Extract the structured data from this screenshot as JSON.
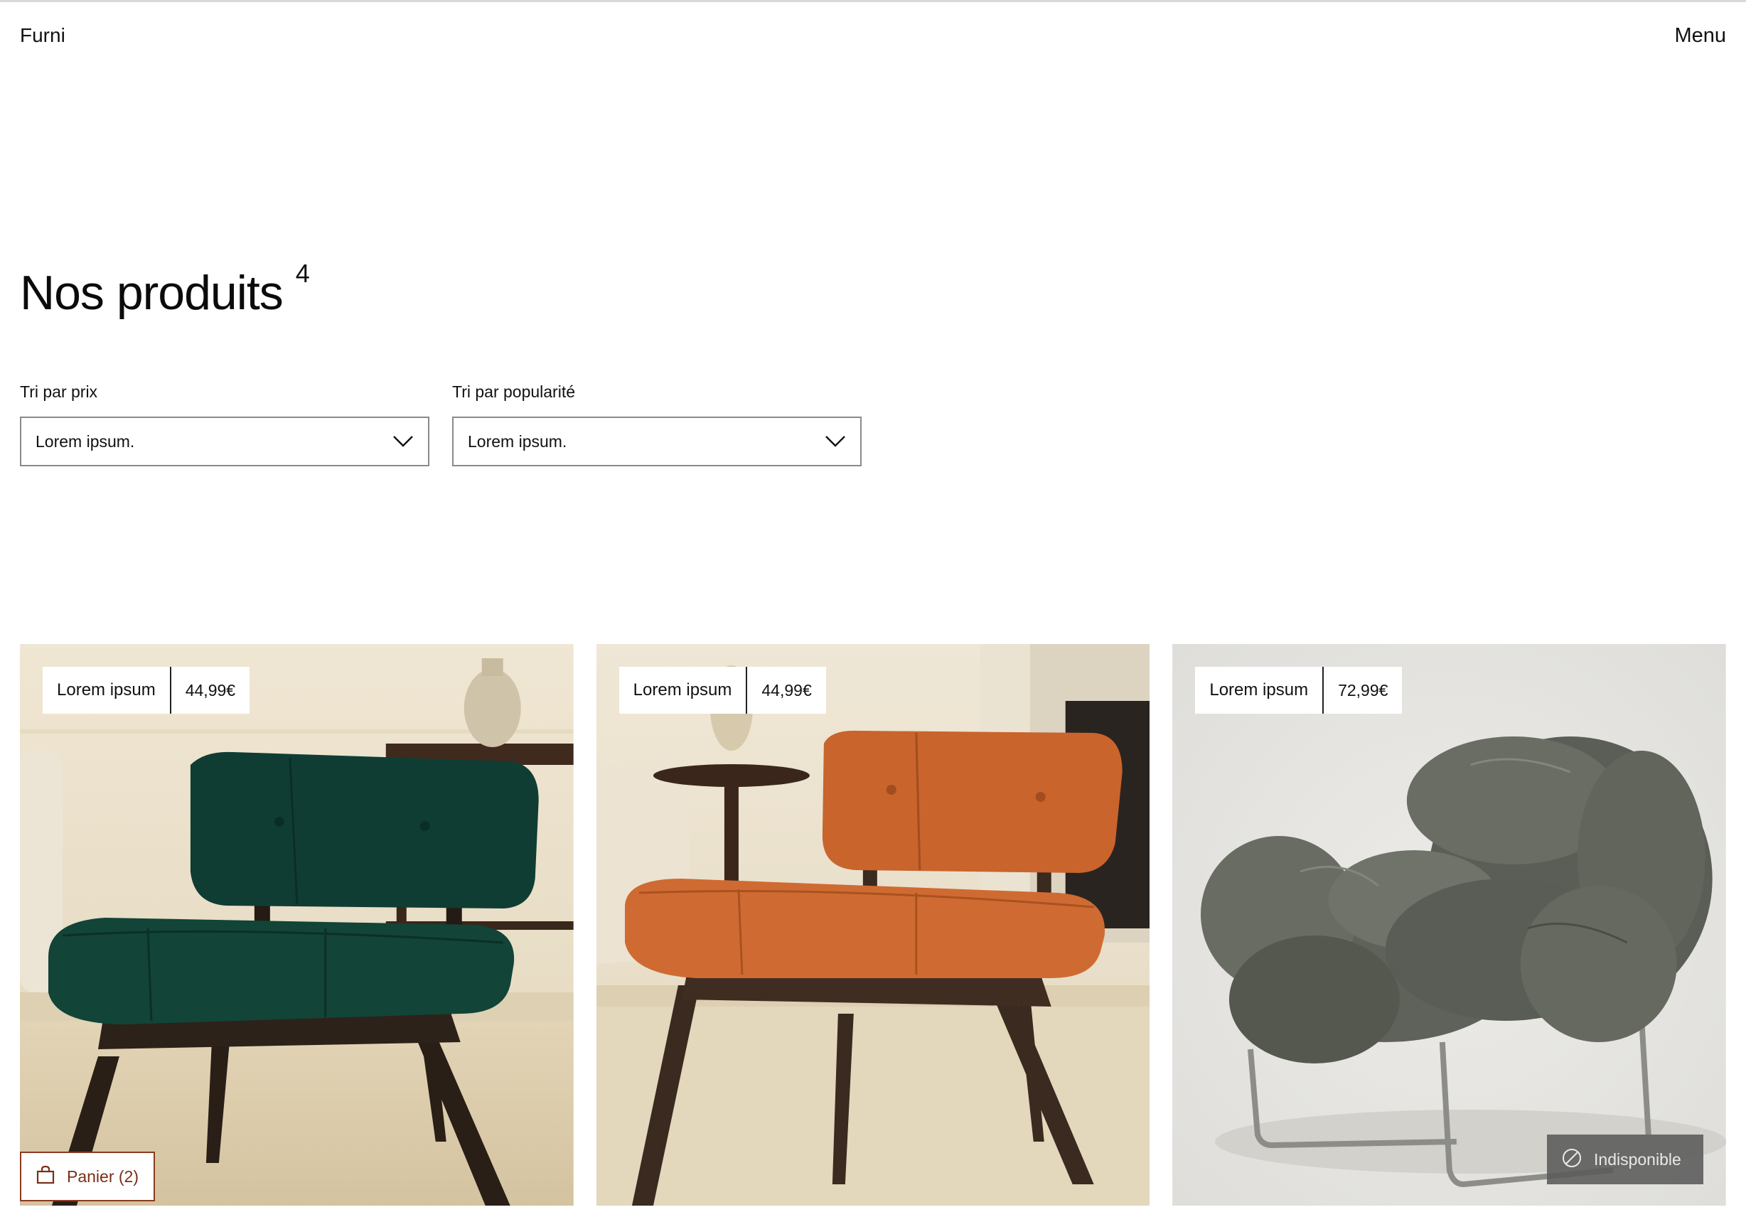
{
  "header": {
    "brand": "Furni",
    "menu_label": "Menu"
  },
  "page": {
    "title": "Nos produits",
    "count": "4"
  },
  "filters": [
    {
      "label": "Tri par prix",
      "value": "Lorem ipsum.",
      "icon": "chevron-down-icon"
    },
    {
      "label": "Tri par popularité",
      "value": "Lorem ipsum.",
      "icon": "chevron-down-icon"
    }
  ],
  "products": [
    {
      "name": "Lorem ipsum",
      "price": "44,99€",
      "image": "green-velvet-chair",
      "color": "#0f3d33"
    },
    {
      "name": "Lorem ipsum",
      "price": "44,99€",
      "image": "orange-velvet-chair",
      "color": "#c9642c"
    },
    {
      "name": "Lorem ipsum",
      "price": "72,99€",
      "image": "grey-leather-armchair",
      "color": "#5b5e56",
      "status": "Indisponible"
    }
  ],
  "cart": {
    "label": "Panier (2)",
    "icon": "shopping-bag-icon",
    "color": "#8b3a1e"
  },
  "colors": {
    "background": "#ffffff",
    "text": "#111111",
    "accent": "#8b3a1e"
  }
}
